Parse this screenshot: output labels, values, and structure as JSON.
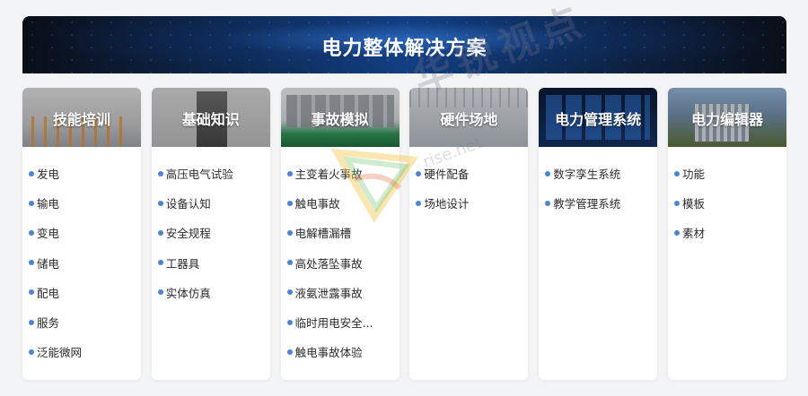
{
  "banner": {
    "title": "电力整体解决方案"
  },
  "cards": [
    {
      "title": "技能培训",
      "items": [
        "发电",
        "输电",
        "变电",
        "储电",
        "配电",
        "服务",
        "泛能微网"
      ]
    },
    {
      "title": "基础知识",
      "items": [
        "高压电气试验",
        "设备认知",
        "安全规程",
        "工器具",
        "实体仿真"
      ]
    },
    {
      "title": "事故模拟",
      "items": [
        "主变着火事故",
        "触电事故",
        "电解槽漏槽",
        "高处落坠事故",
        "液氨泄露事故",
        "临时用电安全...",
        "触电事故体验"
      ]
    },
    {
      "title": "硬件场地",
      "items": [
        "硬件配备",
        "场地设计"
      ]
    },
    {
      "title": "电力管理系统",
      "items": [
        "数字孪生系统",
        "教学管理系统"
      ]
    },
    {
      "title": "电力编辑器",
      "items": [
        "功能",
        "模板",
        "素材"
      ]
    }
  ],
  "watermark": {
    "text": "华锐视点",
    "subtext": "rise.net"
  },
  "colors": {
    "bullet": "#4a84d6",
    "banner_accent": "#123f80"
  }
}
